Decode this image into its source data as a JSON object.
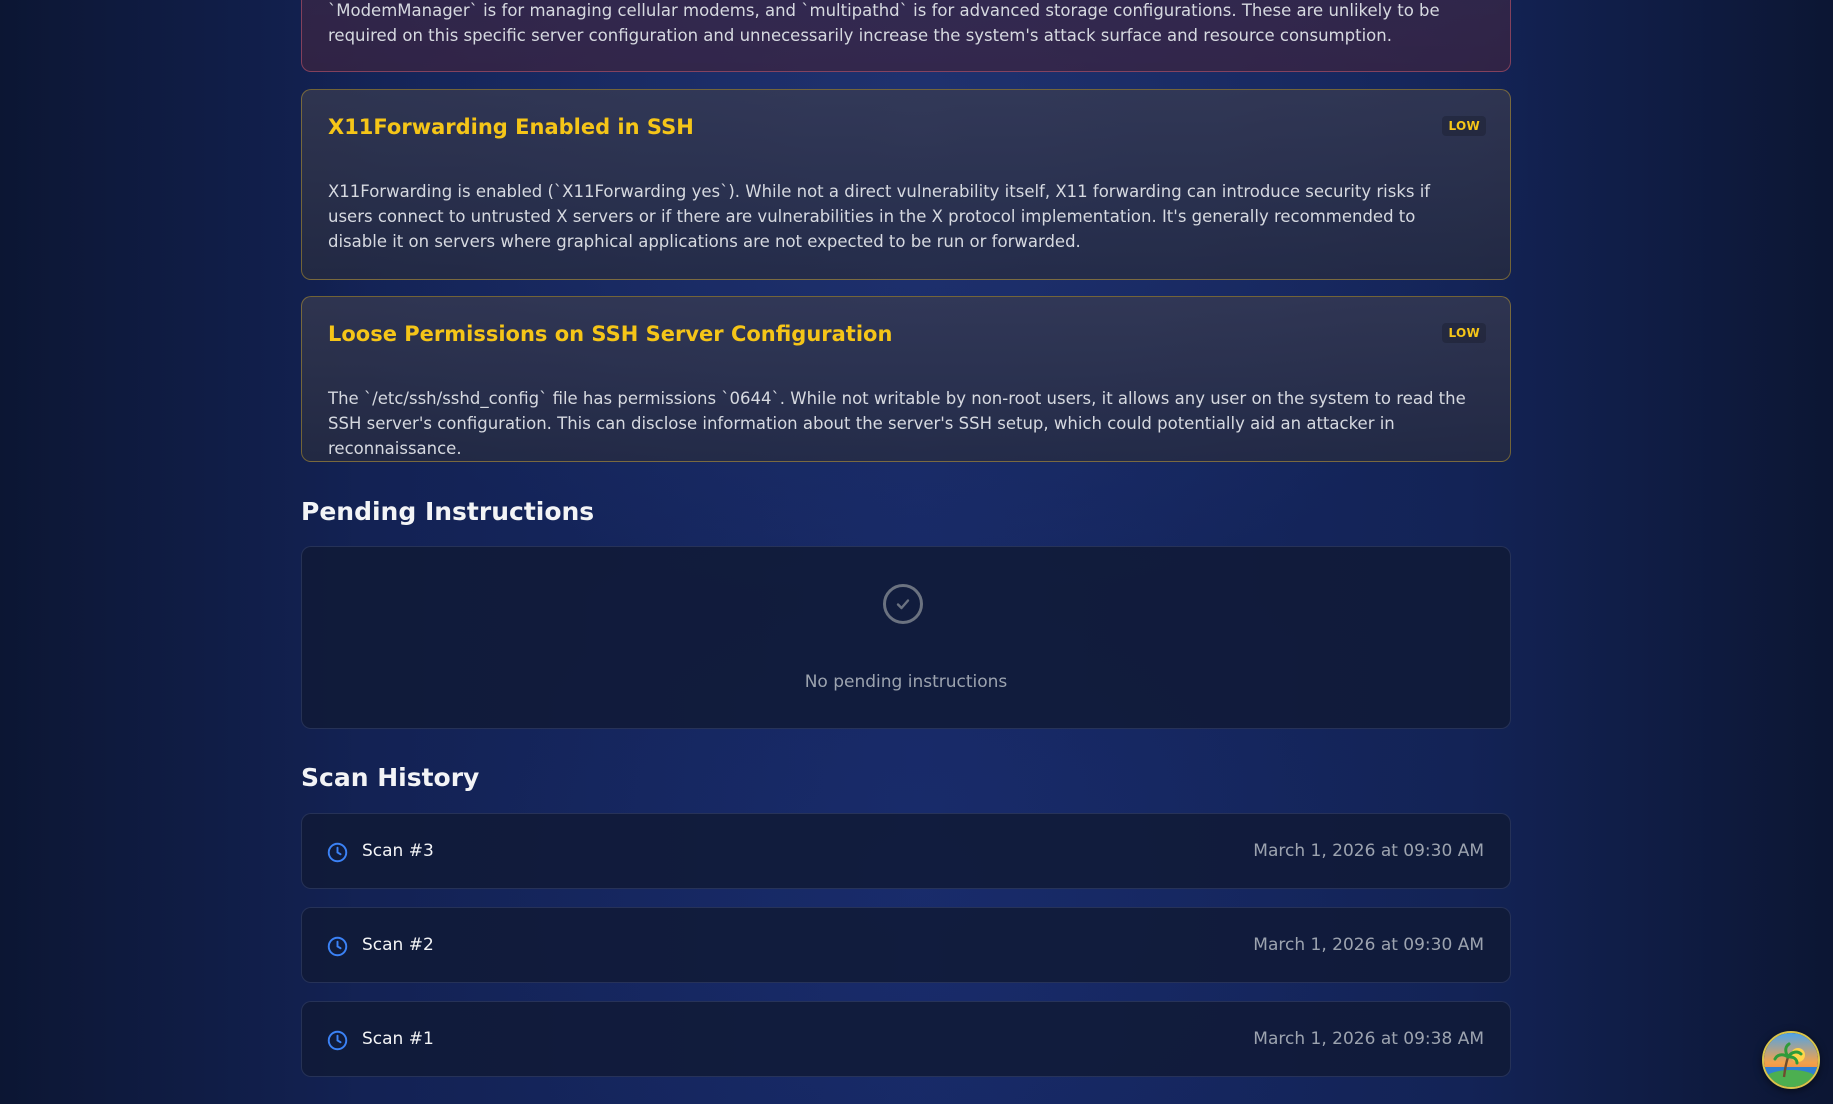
{
  "findings": [
    {
      "text": "`ModemManager` is for managing cellular modems, and `multipathd` is for advanced storage configurations. These are unlikely to be required on this specific server configuration and unnecessarily increase the system's attack surface and resource consumption."
    },
    {
      "title": "X11Forwarding Enabled in SSH",
      "severity": "LOW",
      "text": "X11Forwarding is enabled (`X11Forwarding yes`). While not a direct vulnerability itself, X11 forwarding can introduce security risks if users connect to untrusted X servers or if there are vulnerabilities in the X protocol implementation. It's generally recommended to disable it on servers where graphical applications are not expected to be run or forwarded."
    },
    {
      "title": "Loose Permissions on SSH Server Configuration",
      "severity": "LOW",
      "text": "The `/etc/ssh/sshd_config` file has permissions `0644`. While not writable by non-root users, it allows any user on the system to read the SSH server's configuration. This can disclose information about the server's SSH setup, which could potentially aid an attacker in reconnaissance."
    }
  ],
  "pending": {
    "title": "Pending Instructions",
    "empty_text": "No pending instructions"
  },
  "history": {
    "title": "Scan History",
    "scans": [
      {
        "name": "Scan #3",
        "date": "March 1, 2026 at 09:30 AM"
      },
      {
        "name": "Scan #2",
        "date": "March 1, 2026 at 09:30 AM"
      },
      {
        "name": "Scan #1",
        "date": "March 1, 2026 at 09:38 AM"
      }
    ]
  },
  "colors": {
    "severity_low": "#f5c518",
    "accent_blue": "#3b82f6"
  },
  "icons": {
    "empty": "check-circle-icon",
    "scan": "clock-icon",
    "avatar": "tropical-island-avatar"
  }
}
